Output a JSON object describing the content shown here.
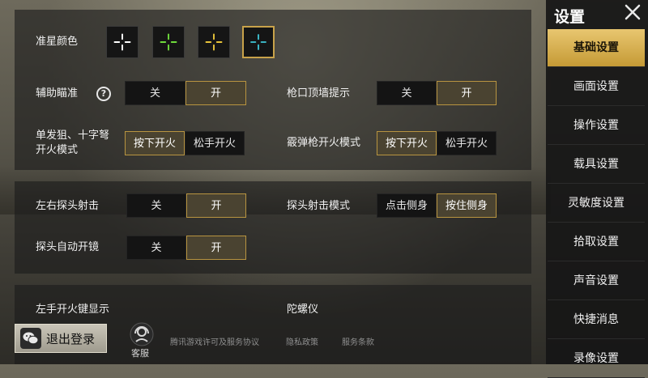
{
  "sidebar": {
    "title": "设置",
    "items": [
      {
        "label": "基础设置",
        "active": true
      },
      {
        "label": "画面设置"
      },
      {
        "label": "操作设置"
      },
      {
        "label": "载具设置"
      },
      {
        "label": "灵敏度设置"
      },
      {
        "label": "拾取设置"
      },
      {
        "label": "声音设置"
      },
      {
        "label": "快捷消息"
      },
      {
        "label": "录像设置"
      }
    ]
  },
  "crosshair": {
    "label": "准星颜色",
    "colors": [
      "#ffffff",
      "#6fdc3c",
      "#e8c43a",
      "#3fc8d8"
    ],
    "selected_index": 3
  },
  "settings": {
    "aim_assist": {
      "label": "辅助瞄准",
      "help_icon": "?",
      "options": [
        "关",
        "开"
      ],
      "selected": "开"
    },
    "muzzle_wall": {
      "label": "枪口顶墙提示",
      "options": [
        "关",
        "开"
      ],
      "selected": "开"
    },
    "sniper_fire": {
      "label": "单发狙、十字弩\n开火模式",
      "label_line1": "单发狙、十字弩",
      "label_line2": "开火模式",
      "options": [
        "按下开火",
        "松手开火"
      ],
      "selected": "按下开火"
    },
    "shotgun_fire": {
      "label": "霰弹枪开火模式",
      "options": [
        "按下开火",
        "松手开火"
      ],
      "selected": "按下开火"
    },
    "lean_fire": {
      "label": "左右探头射击",
      "options": [
        "关",
        "开"
      ],
      "selected": "开"
    },
    "lean_mode": {
      "label": "探头射击模式",
      "options": [
        "点击侧身",
        "按住侧身"
      ],
      "selected": "按住侧身"
    },
    "lean_scope": {
      "label": "探头自动开镜",
      "options": [
        "关",
        "开"
      ],
      "selected": "开"
    },
    "left_fire": {
      "label": "左手开火键显示"
    },
    "gyro": {
      "label": "陀螺仪"
    }
  },
  "footer": {
    "logout_label": "退出登录",
    "support_label": "客服",
    "links": [
      "腾讯游戏许可及服务协议",
      "隐私政策",
      "服务条款"
    ]
  }
}
